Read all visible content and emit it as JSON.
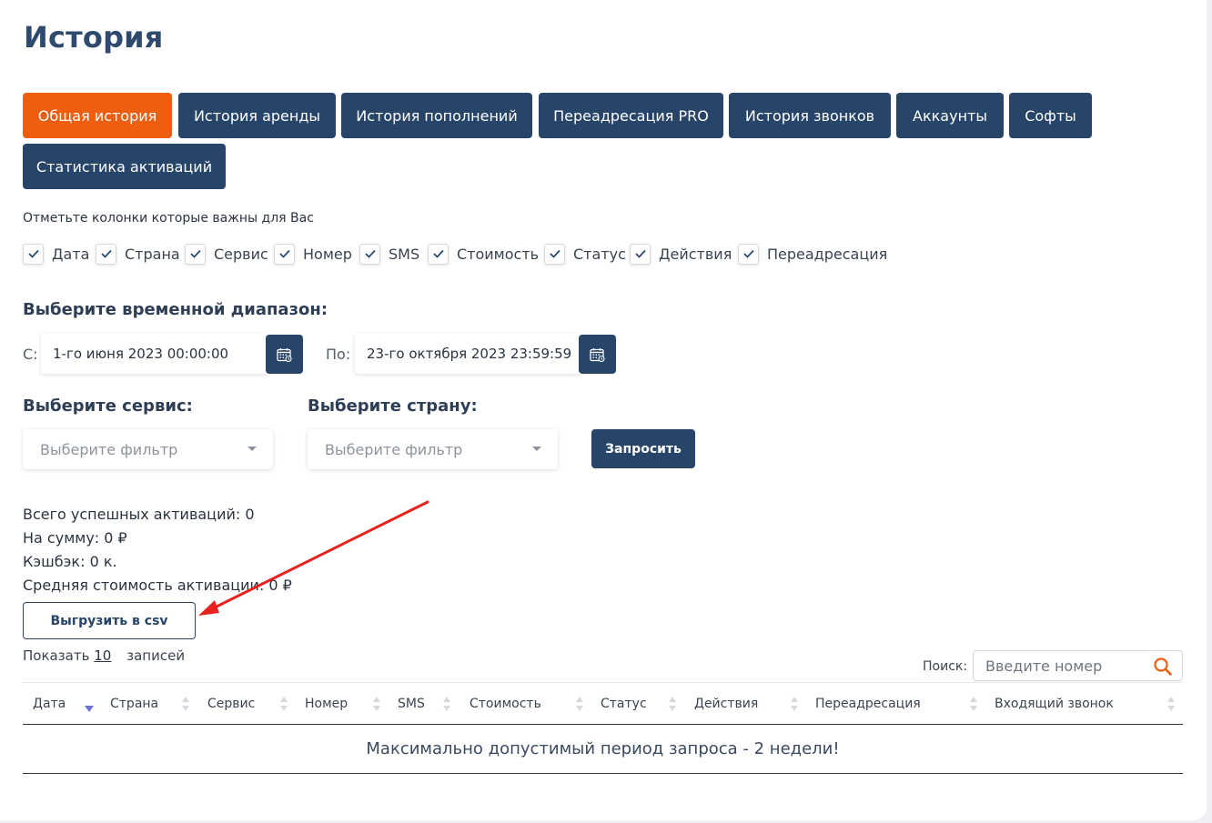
{
  "page": {
    "title": "История"
  },
  "tabs": [
    {
      "label": "Общая история",
      "active": true
    },
    {
      "label": "История аренды"
    },
    {
      "label": "История пополнений"
    },
    {
      "label": "Переадресация PRO"
    },
    {
      "label": "История звонков"
    },
    {
      "label": "Аккаунты"
    },
    {
      "label": "Софты"
    },
    {
      "label": "Статистика активаций"
    }
  ],
  "columns_hint": "Отметьте колонки которые важны для Вас",
  "column_toggles": [
    {
      "label": "Дата",
      "checked": true
    },
    {
      "label": "Страна",
      "checked": true
    },
    {
      "label": "Сервис",
      "checked": true
    },
    {
      "label": "Номер",
      "checked": true
    },
    {
      "label": "SMS",
      "checked": true
    },
    {
      "label": "Стоимость",
      "checked": true
    },
    {
      "label": "Статус",
      "checked": true
    },
    {
      "label": "Действия",
      "checked": true
    },
    {
      "label": "Переадресация",
      "checked": true
    }
  ],
  "range": {
    "heading": "Выберите временной диапазон:",
    "from_label": "С:",
    "from_value": "1-го июня 2023 00:00:00",
    "to_label": "По:",
    "to_value": "23-го октября 2023 23:59:59"
  },
  "filters": {
    "service_heading": "Выберите сервис:",
    "service_placeholder": "Выберите фильтр",
    "country_heading": "Выберите страну:",
    "country_placeholder": "Выберите фильтр",
    "request_label": "Запросить"
  },
  "stats": {
    "total": "Всего успешных активаций: 0",
    "sum": "На сумму: 0 ₽",
    "cashback": "Кэшбэк: 0 к.",
    "avg": "Средняя стоимость активации: 0 ₽"
  },
  "export_label": "Выгрузить в csv",
  "pagination": {
    "show": "Показать",
    "count": "10",
    "records": "записей"
  },
  "search": {
    "label": "Поиск:",
    "placeholder": "Введите номер"
  },
  "table": {
    "headers": [
      "Дата",
      "Страна",
      "Сервис",
      "Номер",
      "SMS",
      "Стоимость",
      "Статус",
      "Действия",
      "Переадресация",
      "Входящий звонок"
    ],
    "sorted_column": "Дата",
    "sort_direction": "desc",
    "empty_message": "Максимально допустимый период запроса - 2 недели!"
  },
  "colors": {
    "primary": "#274469",
    "accent": "#ef5d0f",
    "annotation": "#e8231f"
  }
}
